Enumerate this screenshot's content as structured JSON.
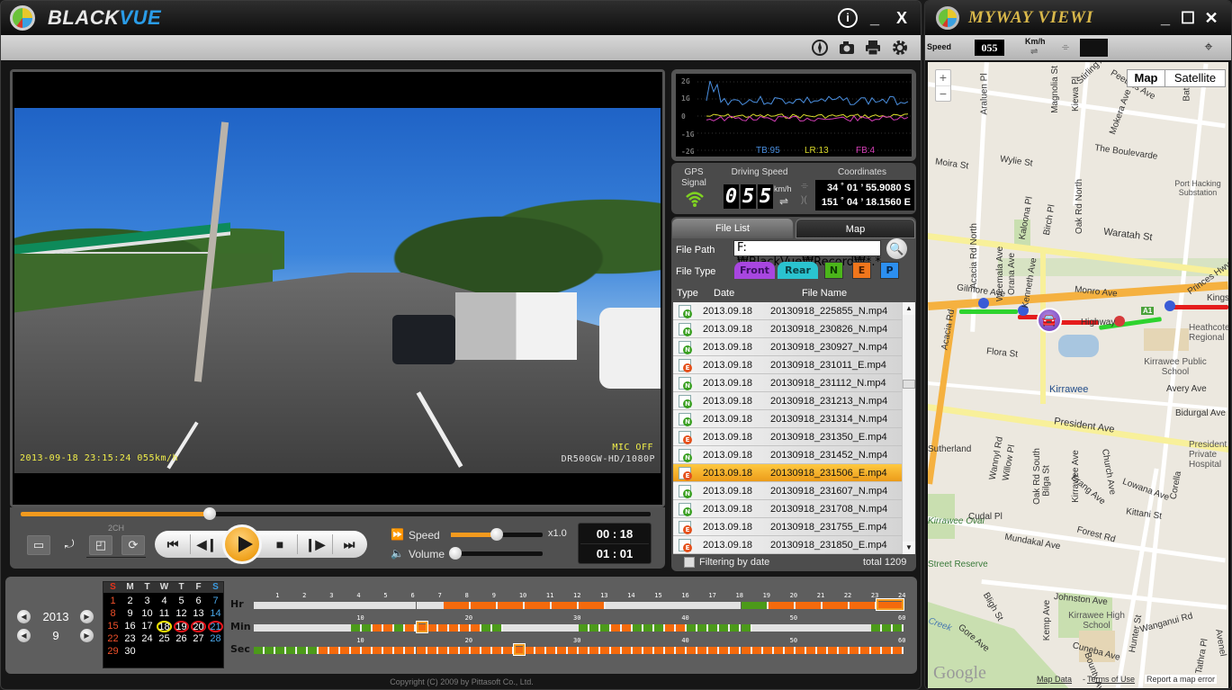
{
  "blackvue": {
    "title_prefix": "BLACK",
    "title_suffix": "VUE",
    "titlebar_buttons": {
      "info": "i",
      "minimize": "_",
      "close": "X"
    },
    "toolbar_icons": [
      "compass-icon",
      "camera-icon",
      "print-icon",
      "settings-icon"
    ],
    "video_osd": {
      "timestamp": "2013-09-18 23:15:24  055km/h",
      "mic": "MIC OFF",
      "model": "DR500GW-HD/1080P"
    },
    "playback": {
      "progress": 0.3,
      "channel_label": "2CH",
      "speed_label": "Speed",
      "volume_label": "Volume",
      "speed_value": "x1.0",
      "speed_slider": 0.5,
      "volume_slider": 0.0,
      "elapsed": "00 : 18",
      "duration": "01 : 01"
    },
    "gsensor": {
      "axis_labels": [
        "2G",
        "1G",
        "0",
        "-1G",
        "-2G"
      ],
      "legend": [
        {
          "label": "TB:95",
          "color": "#4a8fe0"
        },
        {
          "label": "LR:13",
          "color": "#d9d92a"
        },
        {
          "label": "FB:4",
          "color": "#d63fb8"
        }
      ]
    },
    "gps": {
      "gps_label_1": "GPS",
      "gps_label_2": "Signal",
      "driving_speed_label": "Driving Speed",
      "speed_digits": [
        "0",
        "5",
        "5"
      ],
      "speed_unit": "km/h",
      "swap_symbol": "⇌",
      "coordinates_label": "Coordinates",
      "latitude": "34 ˚  01 ’ 55.9080 S",
      "longitude": "151 ˚  04 ’ 18.1560 E"
    },
    "file_panel": {
      "tabs": [
        "File List",
        "Map"
      ],
      "file_path_label": "File Path",
      "file_path_value": "F:₩BlackVue₩Record₩*.*",
      "file_type_label": "File Type",
      "type_buttons": {
        "front": "Front",
        "rear": "Rear",
        "n": "N",
        "e": "E",
        "p": "P"
      },
      "columns": [
        "Type",
        "Date",
        "File Name"
      ],
      "files": [
        {
          "type": "N",
          "date": "2013.09.18",
          "name": "20130918_225855_N.mp4"
        },
        {
          "type": "N",
          "date": "2013.09.18",
          "name": "20130918_230826_N.mp4"
        },
        {
          "type": "N",
          "date": "2013.09.18",
          "name": "20130918_230927_N.mp4"
        },
        {
          "type": "E",
          "date": "2013.09.18",
          "name": "20130918_231011_E.mp4"
        },
        {
          "type": "N",
          "date": "2013.09.18",
          "name": "20130918_231112_N.mp4"
        },
        {
          "type": "N",
          "date": "2013.09.18",
          "name": "20130918_231213_N.mp4"
        },
        {
          "type": "N",
          "date": "2013.09.18",
          "name": "20130918_231314_N.mp4"
        },
        {
          "type": "E",
          "date": "2013.09.18",
          "name": "20130918_231350_E.mp4"
        },
        {
          "type": "N",
          "date": "2013.09.18",
          "name": "20130918_231452_N.mp4"
        },
        {
          "type": "E",
          "date": "2013.09.18",
          "name": "20130918_231506_E.mp4",
          "selected": true
        },
        {
          "type": "N",
          "date": "2013.09.18",
          "name": "20130918_231607_N.mp4"
        },
        {
          "type": "N",
          "date": "2013.09.18",
          "name": "20130918_231708_N.mp4"
        },
        {
          "type": "E",
          "date": "2013.09.18",
          "name": "20130918_231755_E.mp4"
        },
        {
          "type": "E",
          "date": "2013.09.18",
          "name": "20130918_231850_E.mp4"
        }
      ],
      "filter_label": "Filtering by date",
      "total_label": "total 1209"
    },
    "calendar": {
      "year": "2013",
      "month": "9",
      "weekdays": [
        "S",
        "M",
        "T",
        "W",
        "T",
        "F",
        "S"
      ],
      "weeks": [
        [
          "1",
          "2",
          "3",
          "4",
          "5",
          "6",
          "7"
        ],
        [
          "8",
          "9",
          "10",
          "11",
          "12",
          "13",
          "14"
        ],
        [
          "15",
          "16",
          "17",
          "18",
          "19",
          "20",
          "21"
        ],
        [
          "22",
          "23",
          "24",
          "25",
          "26",
          "27",
          "28"
        ],
        [
          "29",
          "30",
          "",
          "",
          "",
          "",
          ""
        ]
      ],
      "selected_day": "18",
      "event_days": [
        "19",
        "20",
        "21"
      ]
    },
    "timeline": {
      "hour_label": "Hr",
      "minute_label": "Min",
      "second_label": "Sec",
      "hour_ticks": [
        "1",
        "2",
        "3",
        "4",
        "5",
        "6",
        "7",
        "8",
        "9",
        "10",
        "11",
        "12",
        "13",
        "14",
        "15",
        "16",
        "17",
        "18",
        "19",
        "20",
        "21",
        "22",
        "23",
        "24"
      ],
      "minsec_ticks": [
        "10",
        "20",
        "30",
        "40",
        "50",
        "60"
      ],
      "hour_segments": [
        {
          "from": 0,
          "to": 7,
          "state": "empty"
        },
        {
          "from": 7,
          "to": 13,
          "state": "event"
        },
        {
          "from": 13,
          "to": 18,
          "state": "empty"
        },
        {
          "from": 18,
          "to": 19,
          "state": "normal"
        },
        {
          "from": 19,
          "to": 24,
          "state": "event"
        }
      ],
      "hour_marker": 23,
      "minute_pattern": "EEEEEEEEEENNEEENEEEEEEEENNEEEEEEEENNNNEEEENNNEEEEEEEENNNNNEEEEEEEEENNNNN",
      "minute_states": [
        "empty",
        "empty",
        "empty",
        "empty",
        "empty",
        "empty",
        "empty",
        "empty",
        "empty",
        "normal",
        "normal",
        "event",
        "event",
        "normal",
        "event",
        "event",
        "event",
        "event",
        "event",
        "event",
        "event",
        "normal",
        "normal",
        "empty",
        "empty",
        "empty",
        "empty",
        "empty",
        "empty",
        "empty",
        "normal",
        "normal",
        "normal",
        "event",
        "event",
        "normal",
        "normal",
        "normal",
        "event",
        "event",
        "normal",
        "normal",
        "normal",
        "normal",
        "normal",
        "normal",
        "empty",
        "empty",
        "empty",
        "empty",
        "empty",
        "empty",
        "empty",
        "empty",
        "empty",
        "empty",
        "empty",
        "normal",
        "normal",
        "normal",
        "normal"
      ],
      "minute_marker": 15,
      "second_states_normal_count": 6,
      "second_marker": 24
    },
    "copyright": "Copyright (C) 2009 by Pittasoft Co., Ltd."
  },
  "myway": {
    "title": "MyWay Viewer",
    "title_display": "MYWAY VIEWI",
    "speed_label": "Speed",
    "speed_value": "055",
    "unit_label": "Km/h",
    "swap_symbol": "⇌",
    "map_type_buttons": [
      "Map",
      "Satellite"
    ],
    "zoom_in": "+",
    "zoom_out": "−",
    "streets": [
      "Araluen Pl",
      "Magnolia St",
      "Kiewa Pl",
      "Mokera Ave",
      "Peebles Ave",
      "Stirling Ave",
      "Bath Rd",
      "The Boulevarde",
      "Moira St",
      "Wylie St",
      "Port Hacking Substation",
      "Waratah St",
      "Acacia Rd North",
      "Weemala Ave",
      "Orana Ave",
      "Kaloona Pl",
      "Birch Pl",
      "Oak Rd North",
      "Kenneth Ave",
      "Gilmore Ave",
      "Monro Ave",
      "Princes Hwy",
      "Kings",
      "Acacia Rd",
      "Flora St",
      "Kirrawee",
      "Kirrawee Public School",
      "Heathcote Regional",
      "Avery Ave",
      "Bidurgal Ave",
      "President Ave",
      "President Private Hospital",
      "Sutherland",
      "Wannyl Rd",
      "Willow Pl",
      "Oak Rd South",
      "Bilga St",
      "Kirrawee Ave",
      "Church Ave",
      "Lowana Ave",
      "Kirrawee Oval",
      "Cudal Pl",
      "Erang Ave",
      "Kittani St",
      "Corella",
      "Forest Rd",
      "Mundakal Ave",
      "Johnston Ave",
      "Kemp Ave",
      "Kirrawee High School",
      "Hunter St",
      "Wanganui Rd",
      "Bligh St",
      "Gore Ave",
      "Cuneba Ave",
      "Bounty Ave",
      "Tathra Pl",
      "Avenel",
      "Street Reserve",
      "Creek"
    ],
    "route_shield": "A1",
    "highway_label": "Highway",
    "google_logo": "Google",
    "map_data_link": "Map Data",
    "terms_link": "Terms of Use",
    "report_link": "Report a map error"
  }
}
